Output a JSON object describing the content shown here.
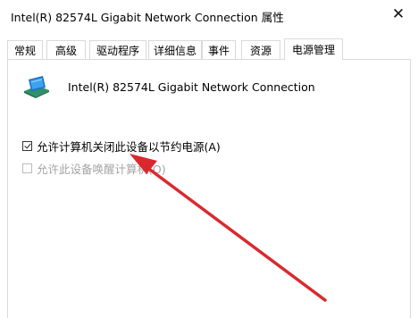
{
  "window": {
    "title": "Intel(R) 82574L Gigabit Network Connection 属性",
    "close_glyph": "✕"
  },
  "tabs": [
    {
      "label": "常规",
      "active": false
    },
    {
      "label": "高级",
      "active": false
    },
    {
      "label": "驱动程序",
      "active": false
    },
    {
      "label": "详细信息",
      "active": false
    },
    {
      "label": "事件",
      "active": false
    },
    {
      "label": "资源",
      "active": false
    },
    {
      "label": "电源管理",
      "active": true
    }
  ],
  "device": {
    "icon": "network-adapter-icon",
    "name": "Intel(R) 82574L Gigabit Network Connection"
  },
  "options": [
    {
      "label": "允许计算机关闭此设备以节约电源(A)",
      "checked": true,
      "enabled": true
    },
    {
      "label": "允许此设备唤醒计算机(O)",
      "checked": false,
      "enabled": false
    }
  ],
  "annotation": {
    "color": "#d9292f",
    "points_to": "options.0"
  }
}
